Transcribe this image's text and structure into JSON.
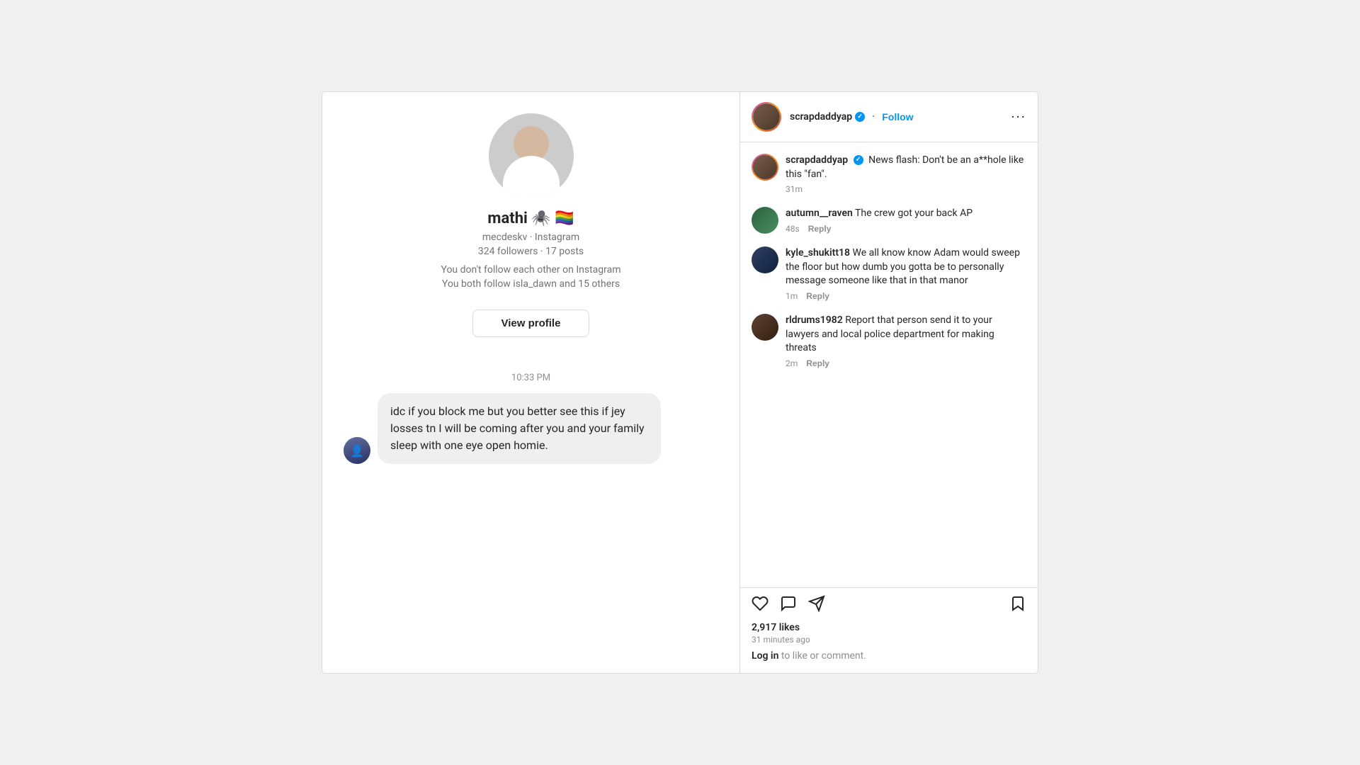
{
  "left": {
    "username": "mathi 🕷️ 🏳️‍🌈",
    "handle": "mecdeskv · Instagram",
    "followers": "324 followers · 17 posts",
    "mutual_line1": "You don't follow each other on Instagram",
    "mutual_line2": "You both follow isla_dawn and 15 others",
    "view_profile_label": "View profile",
    "time_label": "10:33 PM",
    "message_text": "idc if you block me but you better see this if jey losses tn I will be coming after you and your family sleep with one eye open homie."
  },
  "right": {
    "header": {
      "username": "scrapdaddyap",
      "follow_label": "Follow",
      "more_label": "···"
    },
    "comments": [
      {
        "id": "c1",
        "username": "scrapdaddyap",
        "verified": true,
        "text": "News flash: Don't be an a**hole like this \"fan\".",
        "time": "31m",
        "show_reply": false,
        "avatar_class": "grad1"
      },
      {
        "id": "c2",
        "username": "autumn__raven",
        "verified": false,
        "text": "The crew got your back AP",
        "time": "48s",
        "show_reply": true,
        "reply_label": "Reply",
        "avatar_class": "grad2"
      },
      {
        "id": "c3",
        "username": "kyle_shukitt18",
        "verified": false,
        "text": "We all know know Adam would sweep the floor but how dumb you gotta be to personally message someone like that in that manor",
        "time": "1m",
        "show_reply": true,
        "reply_label": "Reply",
        "avatar_class": "grad3"
      },
      {
        "id": "c4",
        "username": "rldrums1982",
        "verified": false,
        "text": "Report that person send it to your lawyers and local police department for making threats",
        "time": "2m",
        "show_reply": true,
        "reply_label": "Reply",
        "avatar_class": "grad4"
      }
    ],
    "likes": "2,917 likes",
    "post_time": "31 minutes ago",
    "log_in_text": "Log in",
    "log_in_suffix": " to like or comment."
  },
  "icons": {
    "like": "♡",
    "comment": "○",
    "share": "▷",
    "bookmark": "⬜",
    "more": "···"
  }
}
